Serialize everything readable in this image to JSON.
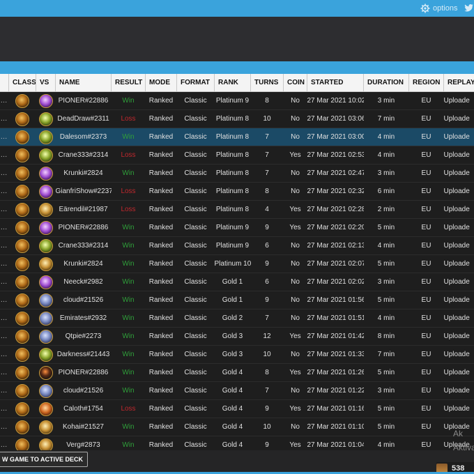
{
  "header": {
    "options_label": "options",
    "accent_color": "#3aa3dc"
  },
  "columns": [
    "CLASS",
    "VS",
    "NAME",
    "RESULT",
    "MODE",
    "FORMAT",
    "RANK",
    "TURNS",
    "COIN",
    "STARTED",
    "DURATION",
    "REGION",
    "REPLAY"
  ],
  "rows": [
    {
      "vs": "vs-purple",
      "name": "PIONER#22886",
      "result": "Win",
      "mode": "Ranked",
      "format": "Classic",
      "rank": "Platinum 9",
      "turns": "8",
      "coin": "No",
      "started": "27 Mar 2021 10:02",
      "duration": "3 min",
      "region": "EU",
      "replay": "Uploade"
    },
    {
      "vs": "vs-green",
      "name": "DeadDraw#2311",
      "result": "Loss",
      "mode": "Ranked",
      "format": "Classic",
      "rank": "Platinum 8",
      "turns": "10",
      "coin": "No",
      "started": "27 Mar 2021 03:06",
      "duration": "7 min",
      "region": "EU",
      "replay": "Uploade"
    },
    {
      "vs": "vs-green",
      "name": "Dalesom#2373",
      "result": "Win",
      "mode": "Ranked",
      "format": "Classic",
      "rank": "Platinum 8",
      "turns": "7",
      "coin": "No",
      "started": "27 Mar 2021 03:00",
      "duration": "4 min",
      "region": "EU",
      "replay": "Uploade",
      "selected": true
    },
    {
      "vs": "vs-green",
      "name": "Crane333#2314",
      "result": "Loss",
      "mode": "Ranked",
      "format": "Classic",
      "rank": "Platinum 8",
      "turns": "7",
      "coin": "Yes",
      "started": "27 Mar 2021 02:53",
      "duration": "4 min",
      "region": "EU",
      "replay": "Uploade"
    },
    {
      "vs": "vs-purple",
      "name": "Krunki#2824",
      "result": "Win",
      "mode": "Ranked",
      "format": "Classic",
      "rank": "Platinum 8",
      "turns": "7",
      "coin": "No",
      "started": "27 Mar 2021 02:47",
      "duration": "3 min",
      "region": "EU",
      "replay": "Uploade"
    },
    {
      "vs": "vs-purple",
      "name": "GianfriShow#2237",
      "result": "Loss",
      "mode": "Ranked",
      "format": "Classic",
      "rank": "Platinum 8",
      "turns": "8",
      "coin": "No",
      "started": "27 Mar 2021 02:32",
      "duration": "6 min",
      "region": "EU",
      "replay": "Uploade"
    },
    {
      "vs": "vs-gold",
      "name": "Eärendil#21987",
      "result": "Loss",
      "mode": "Ranked",
      "format": "Classic",
      "rank": "Platinum 8",
      "turns": "4",
      "coin": "Yes",
      "started": "27 Mar 2021 02:28",
      "duration": "2 min",
      "region": "EU",
      "replay": "Uploade"
    },
    {
      "vs": "vs-purple",
      "name": "PIONER#22886",
      "result": "Win",
      "mode": "Ranked",
      "format": "Classic",
      "rank": "Platinum 9",
      "turns": "9",
      "coin": "Yes",
      "started": "27 Mar 2021 02:20",
      "duration": "5 min",
      "region": "EU",
      "replay": "Uploade"
    },
    {
      "vs": "vs-green",
      "name": "Crane333#2314",
      "result": "Win",
      "mode": "Ranked",
      "format": "Classic",
      "rank": "Platinum 9",
      "turns": "6",
      "coin": "No",
      "started": "27 Mar 2021 02:13",
      "duration": "4 min",
      "region": "EU",
      "replay": "Uploade"
    },
    {
      "vs": "vs-gold",
      "name": "Krunki#2824",
      "result": "Win",
      "mode": "Ranked",
      "format": "Classic",
      "rank": "Platinum 10",
      "turns": "9",
      "coin": "No",
      "started": "27 Mar 2021 02:07",
      "duration": "5 min",
      "region": "EU",
      "replay": "Uploade"
    },
    {
      "vs": "vs-purple",
      "name": "Neeck#2982",
      "result": "Win",
      "mode": "Ranked",
      "format": "Classic",
      "rank": "Gold 1",
      "turns": "6",
      "coin": "No",
      "started": "27 Mar 2021 02:02",
      "duration": "3 min",
      "region": "EU",
      "replay": "Uploade"
    },
    {
      "vs": "vs-blue",
      "name": "cloud#21526",
      "result": "Win",
      "mode": "Ranked",
      "format": "Classic",
      "rank": "Gold 1",
      "turns": "9",
      "coin": "No",
      "started": "27 Mar 2021 01:56",
      "duration": "5 min",
      "region": "EU",
      "replay": "Uploade"
    },
    {
      "vs": "vs-blue",
      "name": "Emirates#2932",
      "result": "Win",
      "mode": "Ranked",
      "format": "Classic",
      "rank": "Gold 2",
      "turns": "7",
      "coin": "No",
      "started": "27 Mar 2021 01:51",
      "duration": "4 min",
      "region": "EU",
      "replay": "Uploade"
    },
    {
      "vs": "vs-blue",
      "name": "Qtpie#2273",
      "result": "Win",
      "mode": "Ranked",
      "format": "Classic",
      "rank": "Gold 3",
      "turns": "12",
      "coin": "Yes",
      "started": "27 Mar 2021 01:42",
      "duration": "8 min",
      "region": "EU",
      "replay": "Uploade"
    },
    {
      "vs": "vs-green",
      "name": "Darkness#21443",
      "result": "Win",
      "mode": "Ranked",
      "format": "Classic",
      "rank": "Gold 3",
      "turns": "10",
      "coin": "No",
      "started": "27 Mar 2021 01:33",
      "duration": "7 min",
      "region": "EU",
      "replay": "Uploade"
    },
    {
      "vs": "vs-dark",
      "name": "PIONER#22886",
      "result": "Win",
      "mode": "Ranked",
      "format": "Classic",
      "rank": "Gold 4",
      "turns": "8",
      "coin": "Yes",
      "started": "27 Mar 2021 01:26",
      "duration": "5 min",
      "region": "EU",
      "replay": "Uploade"
    },
    {
      "vs": "vs-blue",
      "name": "cloud#21526",
      "result": "Win",
      "mode": "Ranked",
      "format": "Classic",
      "rank": "Gold 4",
      "turns": "7",
      "coin": "No",
      "started": "27 Mar 2021 01:22",
      "duration": "3 min",
      "region": "EU",
      "replay": "Uploade"
    },
    {
      "vs": "vs-orange",
      "name": "Caloth#1754",
      "result": "Loss",
      "mode": "Ranked",
      "format": "Classic",
      "rank": "Gold 4",
      "turns": "9",
      "coin": "Yes",
      "started": "27 Mar 2021 01:16",
      "duration": "5 min",
      "region": "EU",
      "replay": "Uploade"
    },
    {
      "vs": "vs-gold",
      "name": "Kohai#21527",
      "result": "Win",
      "mode": "Ranked",
      "format": "Classic",
      "rank": "Gold 4",
      "turns": "10",
      "coin": "No",
      "started": "27 Mar 2021 01:10",
      "duration": "5 min",
      "region": "EU",
      "replay": "Uploade"
    },
    {
      "vs": "vs-gold",
      "name": "Verg#2873",
      "result": "Win",
      "mode": "Ranked",
      "format": "Classic",
      "rank": "Gold 4",
      "turns": "9",
      "coin": "Yes",
      "started": "27 Mar 2021 01:04",
      "duration": "4 min",
      "region": "EU",
      "replay": "Uploade"
    }
  ],
  "footer": {
    "deck_button_label": "W GAME TO ACTIVE DECK",
    "watermark_line1": "Ak",
    "watermark_line2": "Aktiva",
    "count": "538"
  }
}
